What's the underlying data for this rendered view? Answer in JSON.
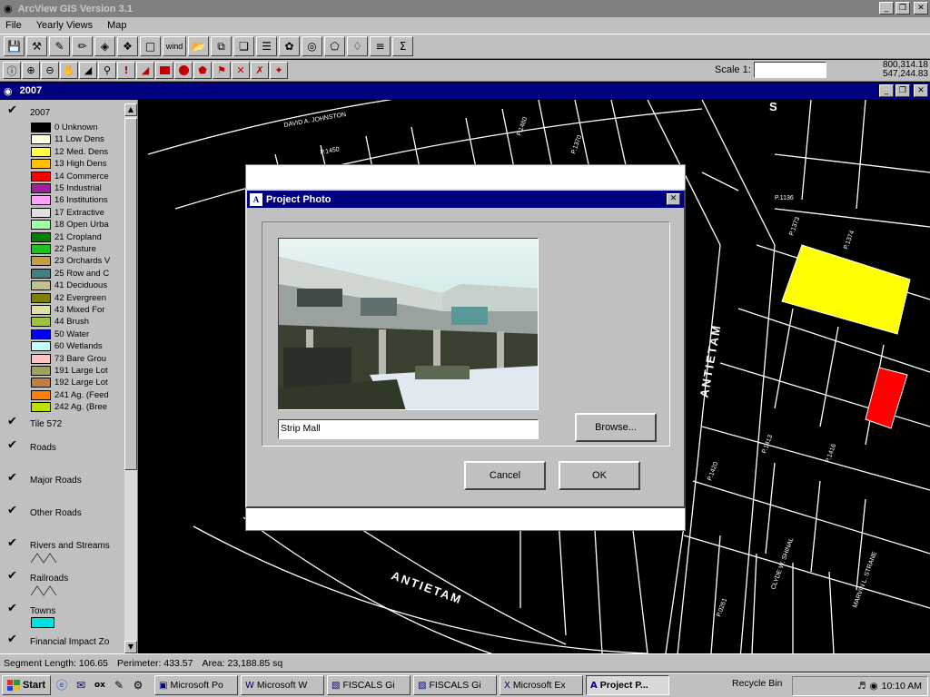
{
  "app": {
    "title": "ArcView GIS Version 3.1"
  },
  "menu": [
    "File",
    "Yearly Views",
    "Map"
  ],
  "toolbar_wide_label": "wind",
  "scale": {
    "label": "Scale 1:",
    "value": ""
  },
  "coords": {
    "x": "800,314.18",
    "y": "547,244.83"
  },
  "document": {
    "title": "2007"
  },
  "legend": {
    "top_layer": "2007",
    "classes": [
      {
        "label": "0 Unknown",
        "color": "#000000"
      },
      {
        "label": "11 Low Dens",
        "color": "#ffffe0"
      },
      {
        "label": "12 Med. Dens",
        "color": "#ffff40"
      },
      {
        "label": "13 High Dens",
        "color": "#ffc000"
      },
      {
        "label": "14 Commerce",
        "color": "#ff0000"
      },
      {
        "label": "15 Industrial",
        "color": "#a020a0"
      },
      {
        "label": "16 Institutions",
        "color": "#ffa0ff"
      },
      {
        "label": "17 Extractive",
        "color": "#e0e0e0"
      },
      {
        "label": "18 Open Urba",
        "color": "#a0ffa0"
      },
      {
        "label": "21 Cropland",
        "color": "#008000"
      },
      {
        "label": "22 Pasture",
        "color": "#20c020"
      },
      {
        "label": "23 Orchards V",
        "color": "#c0a040"
      },
      {
        "label": "25 Row and C",
        "color": "#408080"
      },
      {
        "label": "41 Deciduous",
        "color": "#c0c090"
      },
      {
        "label": "42 Evergreen",
        "color": "#808000"
      },
      {
        "label": "43 Mixed For",
        "color": "#e0e0a0"
      },
      {
        "label": "44 Brush",
        "color": "#a0c040"
      },
      {
        "label": "50 Water",
        "color": "#0000ff"
      },
      {
        "label": "60 Wetlands",
        "color": "#c0ffff"
      },
      {
        "label": "73 Bare Grou",
        "color": "#ffc0c0"
      },
      {
        "label": "191 Large Lot",
        "color": "#a0a060"
      },
      {
        "label": "192 Large Lot",
        "color": "#c08040"
      },
      {
        "label": "241 Ag. (Feed",
        "color": "#ff8000"
      },
      {
        "label": "242 Ag. (Bree",
        "color": "#c0e000"
      }
    ],
    "layers": [
      "Tile 572",
      "Roads",
      "Major Roads",
      "Other Roads",
      "Rivers and Streams",
      "Railroads",
      "Towns",
      "Financial Impact Zo"
    ],
    "towns_color": "#00e0e0"
  },
  "map": {
    "streets": [
      "ANTIETAM",
      "ANTIETAM",
      "S"
    ],
    "highlight_colors": {
      "yellow": "#ffff00",
      "red": "#ff0000"
    }
  },
  "dialog": {
    "title": "Project Photo",
    "caption": "Strip Mall",
    "browse": "Browse...",
    "cancel": "Cancel",
    "ok": "OK"
  },
  "status": {
    "segment": "Segment Length: 106.65",
    "perimeter": "Perimeter: 433.57",
    "area": "Area: 23,188.85 sq"
  },
  "taskbar": {
    "start": "Start",
    "quicklaunch_text": "ox",
    "tasks": [
      "Microsoft Po",
      "Microsoft W",
      "FISCALS Gi",
      "FISCALS Gi",
      "Microsoft Ex",
      "Project P..."
    ],
    "recycle": "Recycle Bin",
    "clock": "10:10 AM"
  }
}
